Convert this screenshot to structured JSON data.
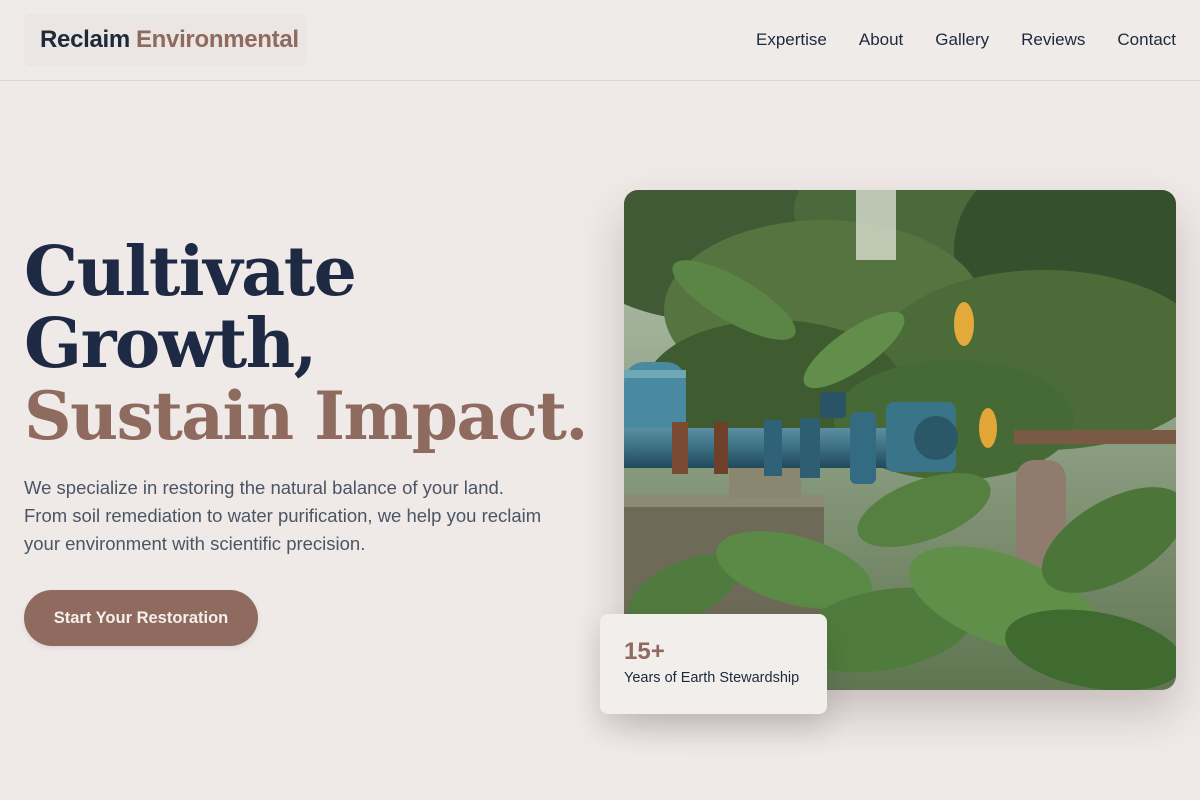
{
  "brand": {
    "name_primary": "Reclaim",
    "name_accent": "Environmental"
  },
  "nav": {
    "items": [
      {
        "label": "Expertise"
      },
      {
        "label": "About"
      },
      {
        "label": "Gallery"
      },
      {
        "label": "Reviews"
      },
      {
        "label": "Contact"
      }
    ]
  },
  "hero": {
    "headline_line1": "Cultivate",
    "headline_line2": "Growth,",
    "headline_line3": "Sustain Impact.",
    "description": "We specialize in restoring the natural balance of your land. From soil remediation to water purification, we help you reclaim your environment with scientific precision.",
    "cta_label": "Start Your Restoration"
  },
  "stat_card": {
    "value": "15+",
    "caption": "Years of Earth Stewardship"
  },
  "colors": {
    "background": "#efe9e8",
    "navy": "#1e2a44",
    "accent_brown": "#8e6b5e",
    "body_text": "#4b5563"
  }
}
